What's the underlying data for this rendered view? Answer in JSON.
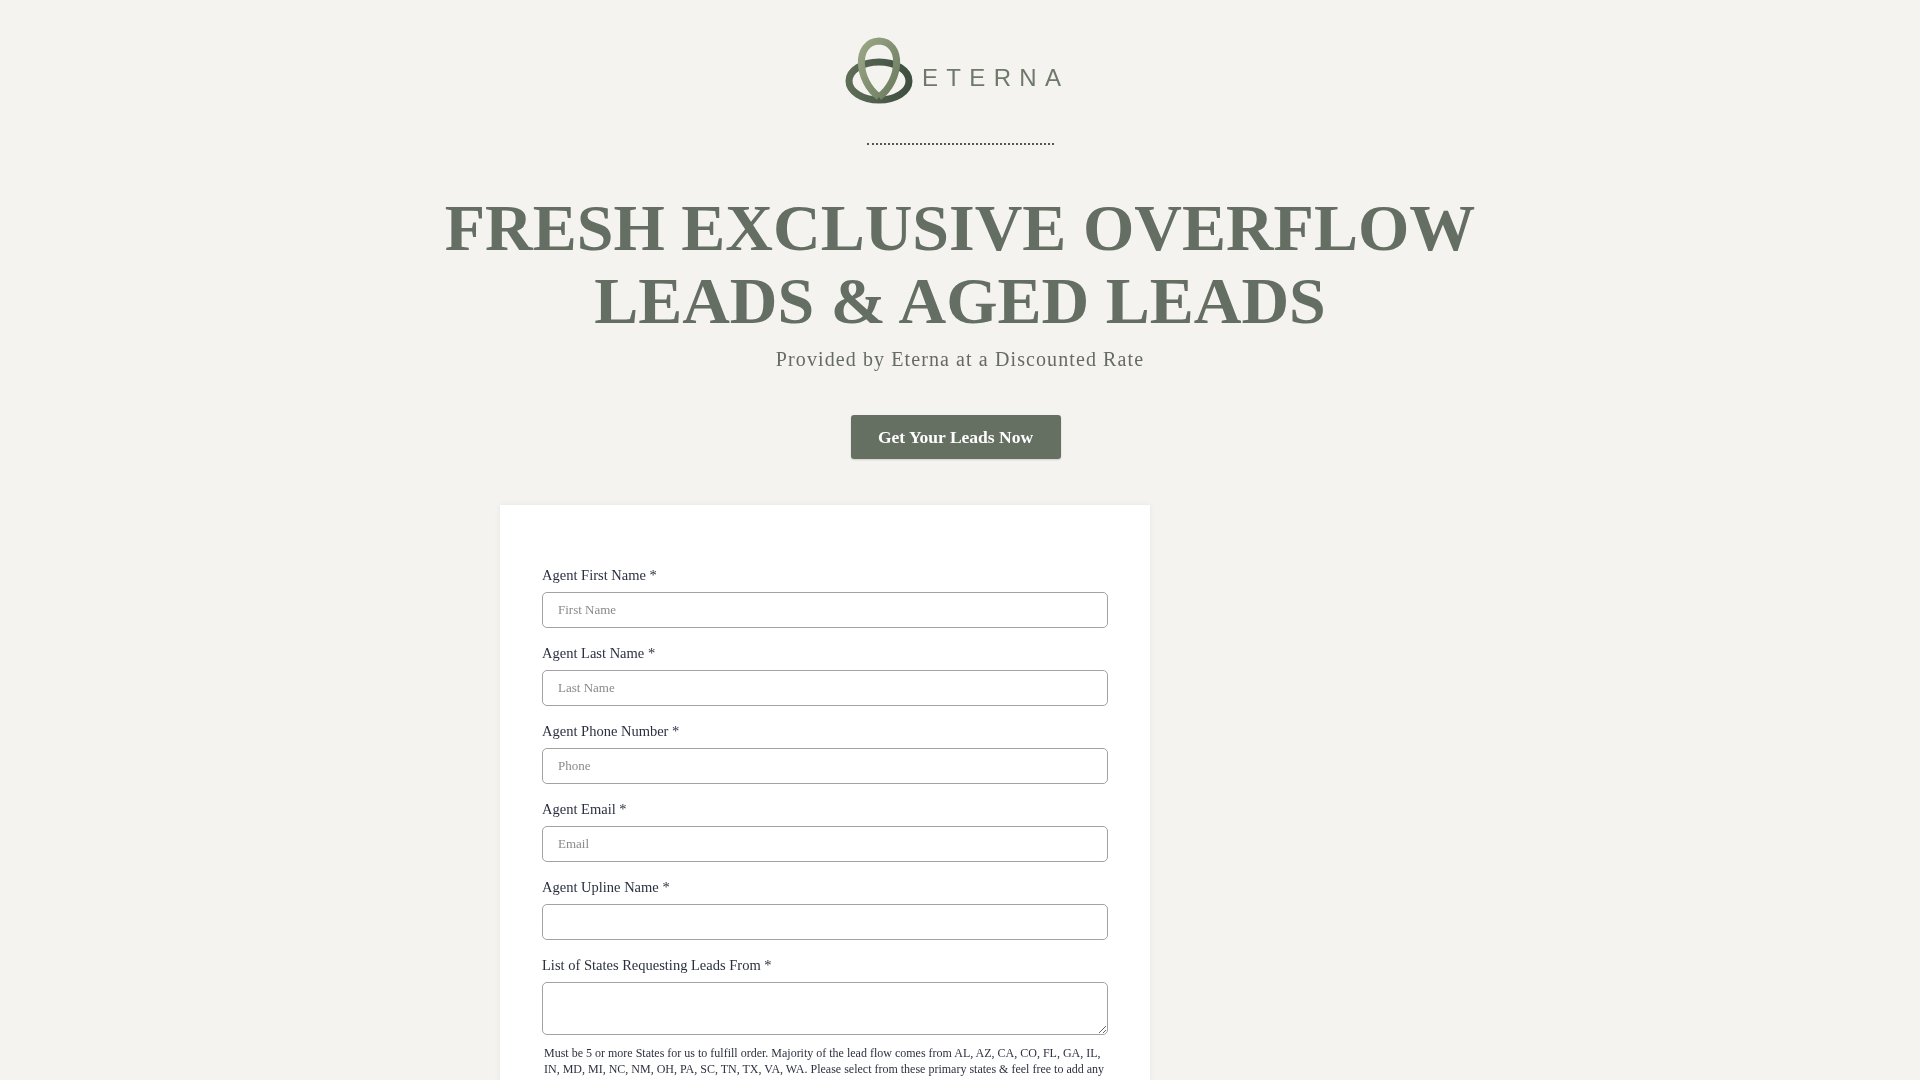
{
  "logo": {
    "text": "ETERNA"
  },
  "hero": {
    "title": "FRESH EXCLUSIVE OVERFLOW LEADS & AGED LEADS",
    "subtitle": "Provided by Eterna at a Discounted Rate",
    "button": "Get Your Leads Now"
  },
  "form": {
    "fields": [
      {
        "kind": "input",
        "label": "Agent First Name *",
        "placeholder": "First Name"
      },
      {
        "kind": "input",
        "label": "Agent Last Name *",
        "placeholder": "Last Name"
      },
      {
        "kind": "input",
        "label": "Agent Phone Number *",
        "placeholder": "Phone"
      },
      {
        "kind": "input",
        "label": "Agent Email *",
        "placeholder": "Email"
      },
      {
        "kind": "input",
        "label": "Agent Upline Name *"
      },
      {
        "kind": "textarea",
        "label": "List of States Requesting Leads From *",
        "note": "Must be 5 or more States for us to fulfill order. Majority of the lead flow comes from AL, AZ, CA, CO, FL, GA, IL, IN, MD, MI, NC, NM, OH, PA, SC, TN, TX, VA, WA. Please select from these primary states & feel free to add any"
      }
    ]
  }
}
